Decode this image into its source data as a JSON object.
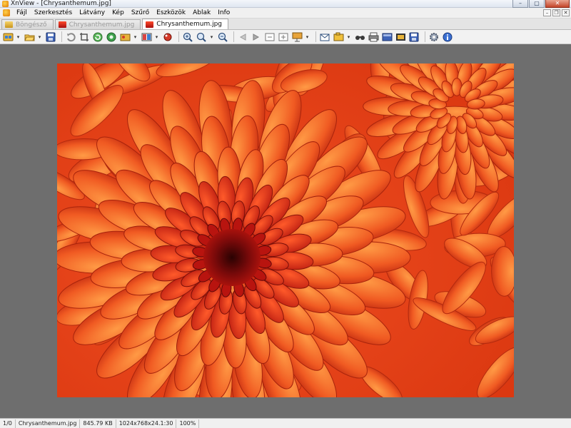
{
  "window": {
    "title": "XnView - [Chrysanthemum.jpg]",
    "buttons": {
      "minimize": "–",
      "maximize": "▢",
      "close": "✕"
    }
  },
  "menu": {
    "items": [
      {
        "label": "Fájl"
      },
      {
        "label": "Szerkesztés"
      },
      {
        "label": "Látvány"
      },
      {
        "label": "Kép"
      },
      {
        "label": "Szűrő"
      },
      {
        "label": "Eszközök"
      },
      {
        "label": "Ablak"
      },
      {
        "label": "Info"
      }
    ],
    "mdi": {
      "minimize": "–",
      "restore": "❐",
      "close": "✕"
    }
  },
  "tabs": [
    {
      "label": "Böngésző",
      "icon": "folder-browser-icon",
      "active": false
    },
    {
      "label": "Chrysanthemum.jpg",
      "icon": "image-icon",
      "active": false
    },
    {
      "label": "Chrysanthemum.jpg",
      "icon": "image-icon",
      "active": true
    }
  ],
  "toolbar": {
    "groups": [
      [
        "browser-icon",
        "dropdown",
        "open-folder-icon",
        "dropdown",
        "save-icon"
      ],
      [
        "rotate-icon",
        "crop-icon",
        "refresh-icon",
        "color-icon",
        "adjust-icon",
        "dropdown",
        "display-icon",
        "dropdown",
        "effects-icon"
      ],
      [
        "zoom-in-icon",
        "zoom-dropdown-icon",
        "dropdown",
        "zoom-out-icon"
      ],
      [
        "previous-icon",
        "next-icon",
        "first-icon",
        "last-icon",
        "slideshow-icon",
        "dropdown"
      ],
      [
        "email-icon",
        "capture-icon",
        "dropdown",
        "find-icon",
        "print-icon",
        "scanner-icon",
        "filmstrip-icon",
        "convert-icon"
      ],
      [
        "settings-icon",
        "info-icon"
      ]
    ]
  },
  "image": {
    "description_icon": "chrysanthemum-photo",
    "colors": {
      "petal_light": "#f47a2c",
      "petal_mid": "#e8441a",
      "petal_dark": "#b51a10",
      "center": "#7a0a0a"
    }
  },
  "status": {
    "index": "1/0",
    "filename": "Chrysanthemum.jpg",
    "filesize": "845.79 KB",
    "dimensions": "1024x768x24.1:30",
    "zoom": "100%"
  }
}
